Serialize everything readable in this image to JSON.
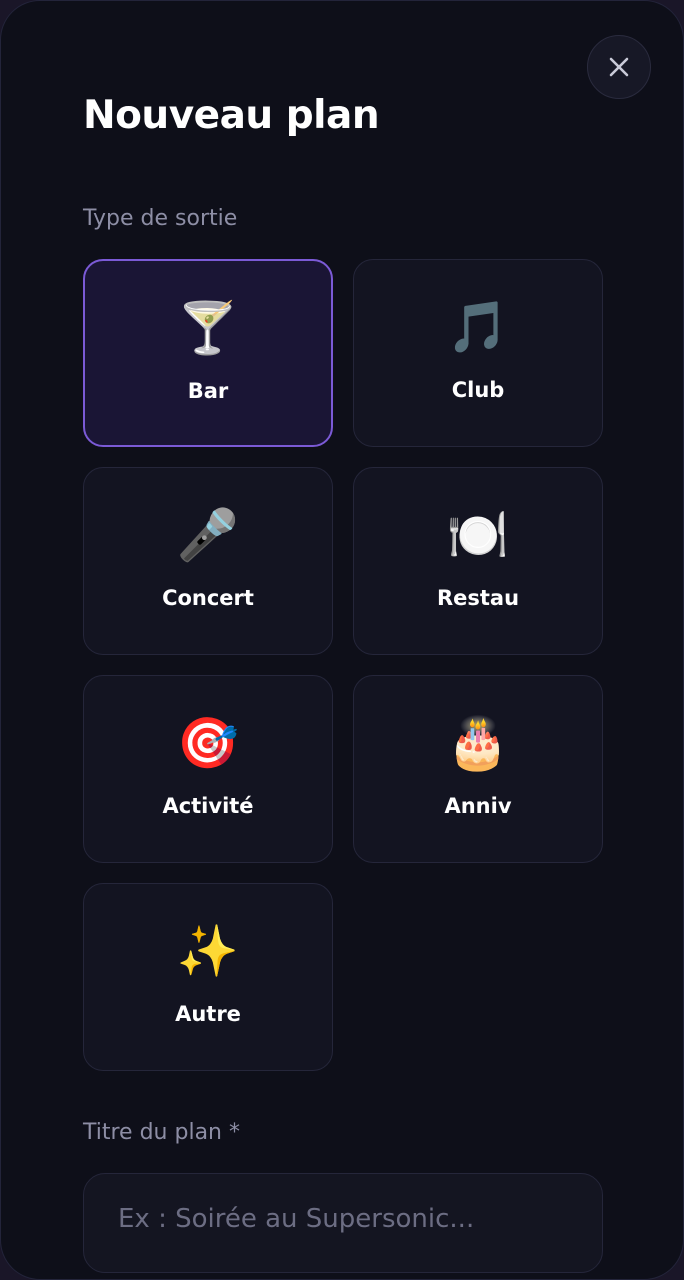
{
  "modal": {
    "title": "Nouveau plan",
    "close_icon": "close-icon"
  },
  "type_section": {
    "label": "Type de sortie",
    "selected": "Bar",
    "options": [
      {
        "label": "Bar",
        "emoji": "🍸",
        "icon": "cocktail-icon"
      },
      {
        "label": "Club",
        "emoji": "🎵",
        "icon": "music-note-icon"
      },
      {
        "label": "Concert",
        "emoji": "🎤",
        "icon": "microphone-icon"
      },
      {
        "label": "Restau",
        "emoji": "🍽️",
        "icon": "plate-cutlery-icon"
      },
      {
        "label": "Activité",
        "emoji": "🎯",
        "icon": "target-icon"
      },
      {
        "label": "Anniv",
        "emoji": "🎂",
        "icon": "birthday-cake-icon"
      },
      {
        "label": "Autre",
        "emoji": "✨",
        "icon": "sparkles-icon"
      }
    ]
  },
  "title_section": {
    "label": "Titre du plan *",
    "placeholder": "Ex : Soirée au Supersonic...",
    "value": ""
  },
  "colors": {
    "background": "#0e0f19",
    "card": "#131421",
    "accent": "#7b5ad6",
    "muted_text": "#8d8ea5"
  }
}
